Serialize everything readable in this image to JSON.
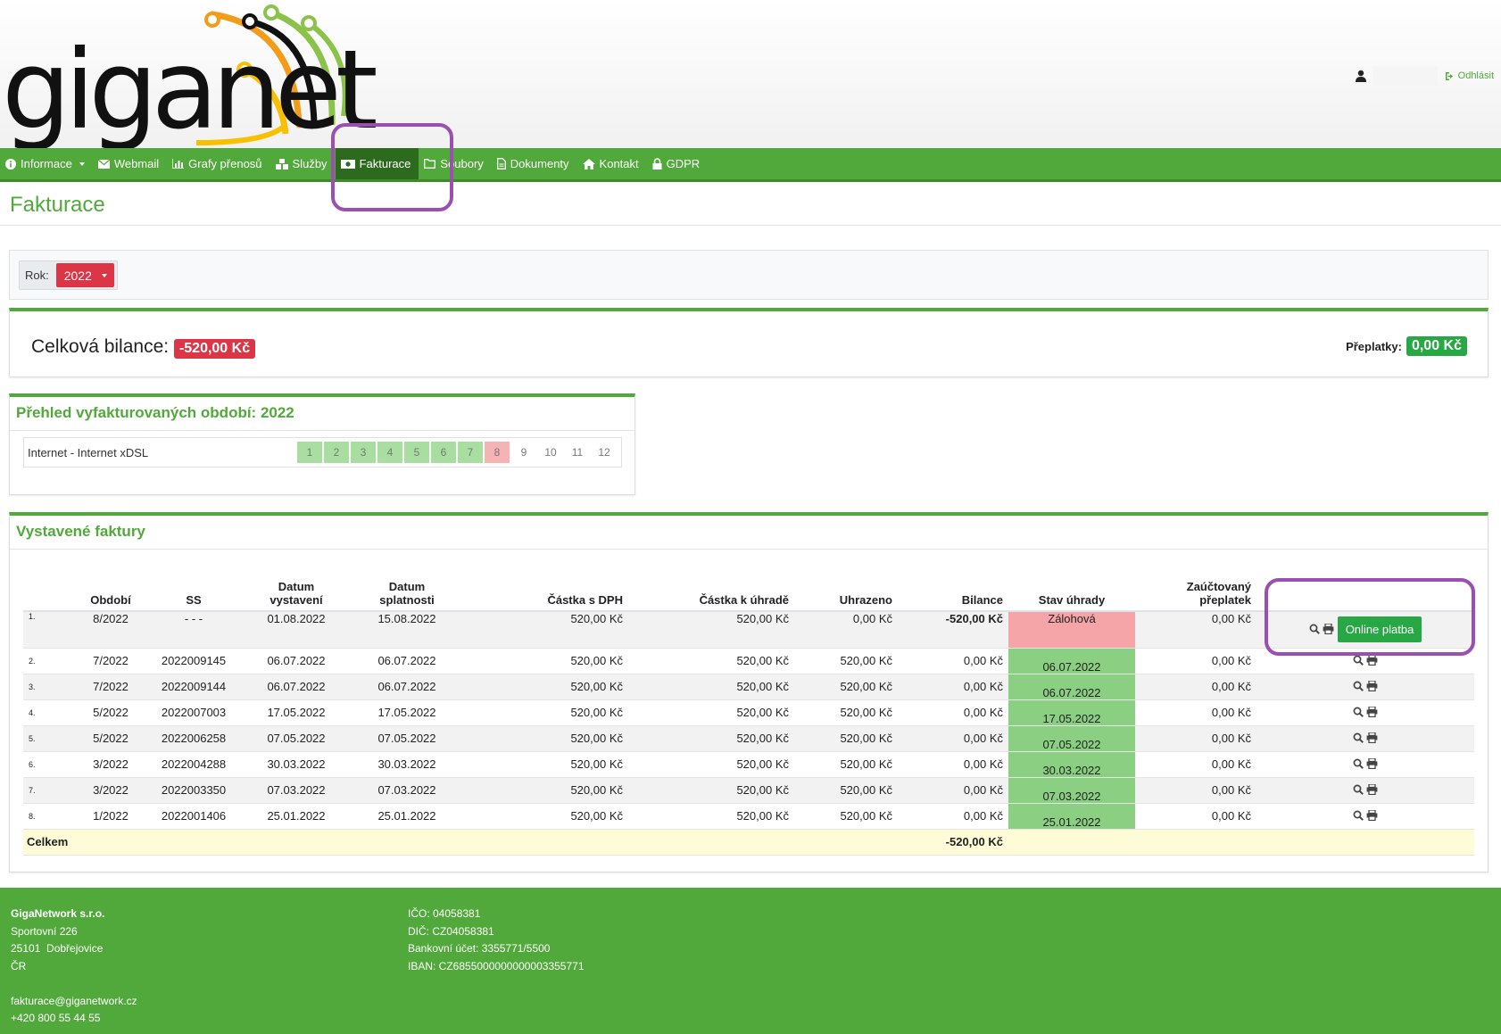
{
  "brand": {
    "logo_text": "giganet"
  },
  "header": {
    "logout_label": "Odhlásit"
  },
  "nav": {
    "items": [
      {
        "label": "Informace",
        "icon": "info-icon",
        "dropdown": true
      },
      {
        "label": "Webmail",
        "icon": "envelope-icon"
      },
      {
        "label": "Grafy přenosů",
        "icon": "bar-chart-icon"
      },
      {
        "label": "Služby",
        "icon": "cubes-icon"
      },
      {
        "label": "Fakturace",
        "icon": "money-icon",
        "active": true
      },
      {
        "label": "Soubory",
        "icon": "folder-icon"
      },
      {
        "label": "Dokumenty",
        "icon": "file-icon"
      },
      {
        "label": "Kontakt",
        "icon": "home-icon"
      },
      {
        "label": "GDPR",
        "icon": "lock-icon"
      }
    ]
  },
  "page": {
    "title": "Fakturace"
  },
  "year_filter": {
    "label": "Rok:",
    "selected": "2022"
  },
  "balance": {
    "label": "Celková bilance:",
    "value": "-520,00 Kč",
    "overpay_label": "Přeplatky:",
    "overpay_value": "0,00 Kč"
  },
  "periods": {
    "title": "Přehled vyfakturovaných období: 2022",
    "service": "Internet - Internet xDSL",
    "months": [
      "1",
      "2",
      "3",
      "4",
      "5",
      "6",
      "7",
      "8",
      "9",
      "10",
      "11",
      "12"
    ],
    "months_paid": 7,
    "months_due": 1
  },
  "invoices": {
    "title": "Vystavené faktury",
    "headers": {
      "obdobi": "Období",
      "ss": "SS",
      "datum_vystaveni_1": "Datum",
      "datum_vystaveni_2": "vystavení",
      "datum_splatnosti_1": "Datum",
      "datum_splatnosti_2": "splatnosti",
      "castka_dph": "Částka s DPH",
      "castka_uhrade": "Částka k úhradě",
      "uhrazeno": "Uhrazeno",
      "bilance": "Bilance",
      "stav": "Stav úhrady",
      "preplatek_1": "Zaúčtovaný",
      "preplatek_2": "přeplatek"
    },
    "online_button": "Online platba",
    "rows": [
      {
        "n": "1.",
        "obdobi": "8/2022",
        "ss": "- - -",
        "vystaveni": "01.08.2022",
        "splatnost": "15.08.2022",
        "castka_dph": "520,00 Kč",
        "k_uhrade": "520,00 Kč",
        "uhrazeno": "0,00 Kč",
        "bilance": "-520,00 Kč",
        "stav": "Zálohová",
        "preplatek": "0,00 Kč",
        "status": "due"
      },
      {
        "n": "2.",
        "obdobi": "7/2022",
        "ss": "2022009145",
        "vystaveni": "06.07.2022",
        "splatnost": "06.07.2022",
        "castka_dph": "520,00 Kč",
        "k_uhrade": "520,00 Kč",
        "uhrazeno": "520,00 Kč",
        "bilance": "0,00 Kč",
        "stav": "06.07.2022",
        "preplatek": "0,00 Kč",
        "status": "paid"
      },
      {
        "n": "3.",
        "obdobi": "7/2022",
        "ss": "2022009144",
        "vystaveni": "06.07.2022",
        "splatnost": "06.07.2022",
        "castka_dph": "520,00 Kč",
        "k_uhrade": "520,00 Kč",
        "uhrazeno": "520,00 Kč",
        "bilance": "0,00 Kč",
        "stav": "06.07.2022",
        "preplatek": "0,00 Kč",
        "status": "paid"
      },
      {
        "n": "4.",
        "obdobi": "5/2022",
        "ss": "2022007003",
        "vystaveni": "17.05.2022",
        "splatnost": "17.05.2022",
        "castka_dph": "520,00 Kč",
        "k_uhrade": "520,00 Kč",
        "uhrazeno": "520,00 Kč",
        "bilance": "0,00 Kč",
        "stav": "17.05.2022",
        "preplatek": "0,00 Kč",
        "status": "paid"
      },
      {
        "n": "5.",
        "obdobi": "5/2022",
        "ss": "2022006258",
        "vystaveni": "07.05.2022",
        "splatnost": "07.05.2022",
        "castka_dph": "520,00 Kč",
        "k_uhrade": "520,00 Kč",
        "uhrazeno": "520,00 Kč",
        "bilance": "0,00 Kč",
        "stav": "07.05.2022",
        "preplatek": "0,00 Kč",
        "status": "paid"
      },
      {
        "n": "6.",
        "obdobi": "3/2022",
        "ss": "2022004288",
        "vystaveni": "30.03.2022",
        "splatnost": "30.03.2022",
        "castka_dph": "520,00 Kč",
        "k_uhrade": "520,00 Kč",
        "uhrazeno": "520,00 Kč",
        "bilance": "0,00 Kč",
        "stav": "30.03.2022",
        "preplatek": "0,00 Kč",
        "status": "paid"
      },
      {
        "n": "7.",
        "obdobi": "3/2022",
        "ss": "2022003350",
        "vystaveni": "07.03.2022",
        "splatnost": "07.03.2022",
        "castka_dph": "520,00 Kč",
        "k_uhrade": "520,00 Kč",
        "uhrazeno": "520,00 Kč",
        "bilance": "0,00 Kč",
        "stav": "07.03.2022",
        "preplatek": "0,00 Kč",
        "status": "paid"
      },
      {
        "n": "8.",
        "obdobi": "1/2022",
        "ss": "2022001406",
        "vystaveni": "25.01.2022",
        "splatnost": "25.01.2022",
        "castka_dph": "520,00 Kč",
        "k_uhrade": "520,00 Kč",
        "uhrazeno": "520,00 Kč",
        "bilance": "0,00 Kč",
        "stav": "25.01.2022",
        "preplatek": "0,00 Kč",
        "status": "paid"
      }
    ],
    "total_label": "Celkem",
    "total_value": "-520,00 Kč"
  },
  "footer": {
    "company": "GigaNetwork s.r.o.",
    "street": "Sportovní 226",
    "city": "25101  Dobřejovice",
    "country": "ČR",
    "email": "fakturace@giganetwork.cz",
    "phone": "+420 800 55 44 55",
    "ico": "IČO: 04058381",
    "dic": "DIČ: CZ04058381",
    "account": "Bankovní účet: 3355771/5500",
    "iban": "IBAN: CZ6855000000000003355771"
  },
  "colors": {
    "brand_green": "#52a93b",
    "active_nav": "#2c6a1d",
    "danger": "#dc3545",
    "success": "#28a745",
    "annotation": "#9b4fb1"
  }
}
